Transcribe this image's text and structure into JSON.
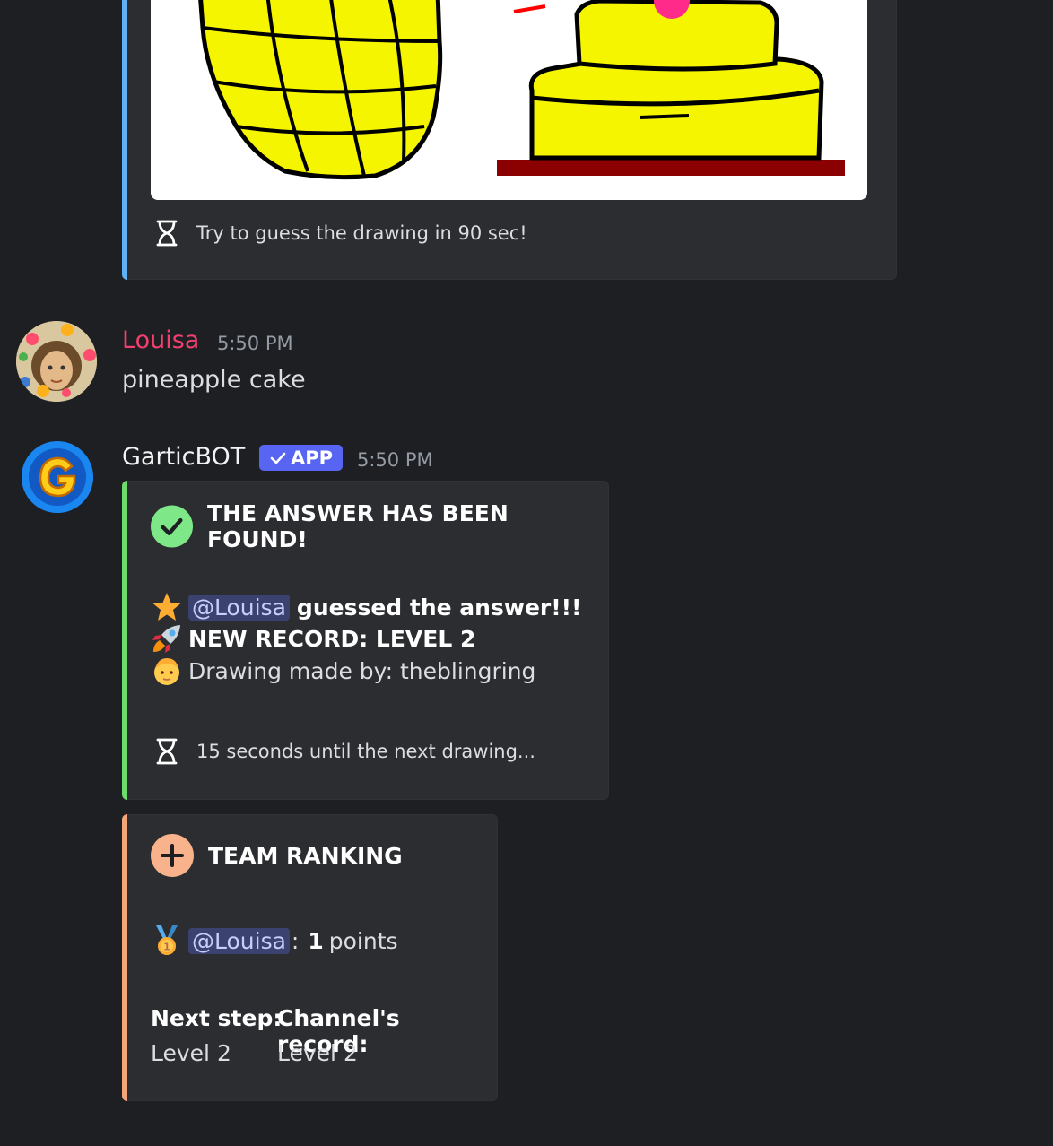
{
  "drawing_embed": {
    "footer_text": "Try to guess the drawing in 90 sec!",
    "footer_icon": "hourglass-icon"
  },
  "messages": [
    {
      "username": "Louisa",
      "username_color": "#f23f6f",
      "timestamp": "5:50 PM",
      "text": "pineapple cake"
    },
    {
      "username": "GarticBOT",
      "username_color": "#f2f3f5",
      "badge": "APP",
      "timestamp": "5:50 PM"
    }
  ],
  "answer_embed": {
    "accent": "#6cdc6c",
    "title": "THE ANSWER HAS BEEN FOUND!",
    "title_icon": "check-circle-icon",
    "mention": "@Louisa",
    "guessed_text": "guessed the answer!!!",
    "record_text": "NEW RECORD: LEVEL 2",
    "drawer_text": "Drawing made by: theblingring",
    "footer_text": "15 seconds until the next drawing..."
  },
  "ranking_embed": {
    "accent": "#f5a57a",
    "title": "TEAM RANKING",
    "title_icon": "plus-circle-icon",
    "mention": "@Louisa",
    "separator": ":",
    "points_value": "1",
    "points_label": "points",
    "fields": [
      {
        "name": "Next step:",
        "value": "Level 2"
      },
      {
        "name": "Channel's record:",
        "value": "Level 2"
      }
    ]
  }
}
